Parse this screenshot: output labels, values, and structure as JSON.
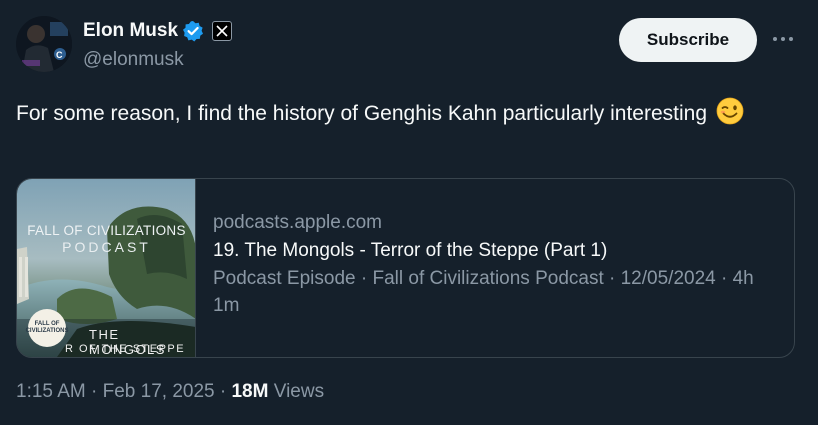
{
  "author": {
    "display_name": "Elon Musk",
    "handle": "@elonmusk",
    "verified_color": "#1d9bf0"
  },
  "actions": {
    "subscribe_label": "Subscribe",
    "more_icon": "more-horizontal-icon"
  },
  "tweet": {
    "text": "For some reason, I find the history of Genghis Kahn particularly interesting",
    "emoji": "winking-face"
  },
  "card": {
    "domain": "podcasts.apple.com",
    "title": "19. The Mongols - Terror of the Steppe (Part 1)",
    "description": "Podcast Episode · Fall of Civilizations Podcast · 12/05/2024 · 4h 1m",
    "thumbnail": {
      "title": "FALL OF CIVILIZATIONS",
      "subtitle": "PODCAST",
      "episode_line1": "THE MONGOLS",
      "episode_line2": "R OF THE STEPPE",
      "badge": "FALL OF CIVILIZATIONS"
    }
  },
  "meta": {
    "time": "1:15 AM",
    "sep1": "·",
    "date": "Feb 17, 2025",
    "sep2": "·",
    "views_count": "18M",
    "views_label": "Views"
  },
  "colors": {
    "background": "#15202b",
    "secondary_text": "#8b98a5",
    "border": "#38444d",
    "button_bg": "#eff3f4"
  }
}
